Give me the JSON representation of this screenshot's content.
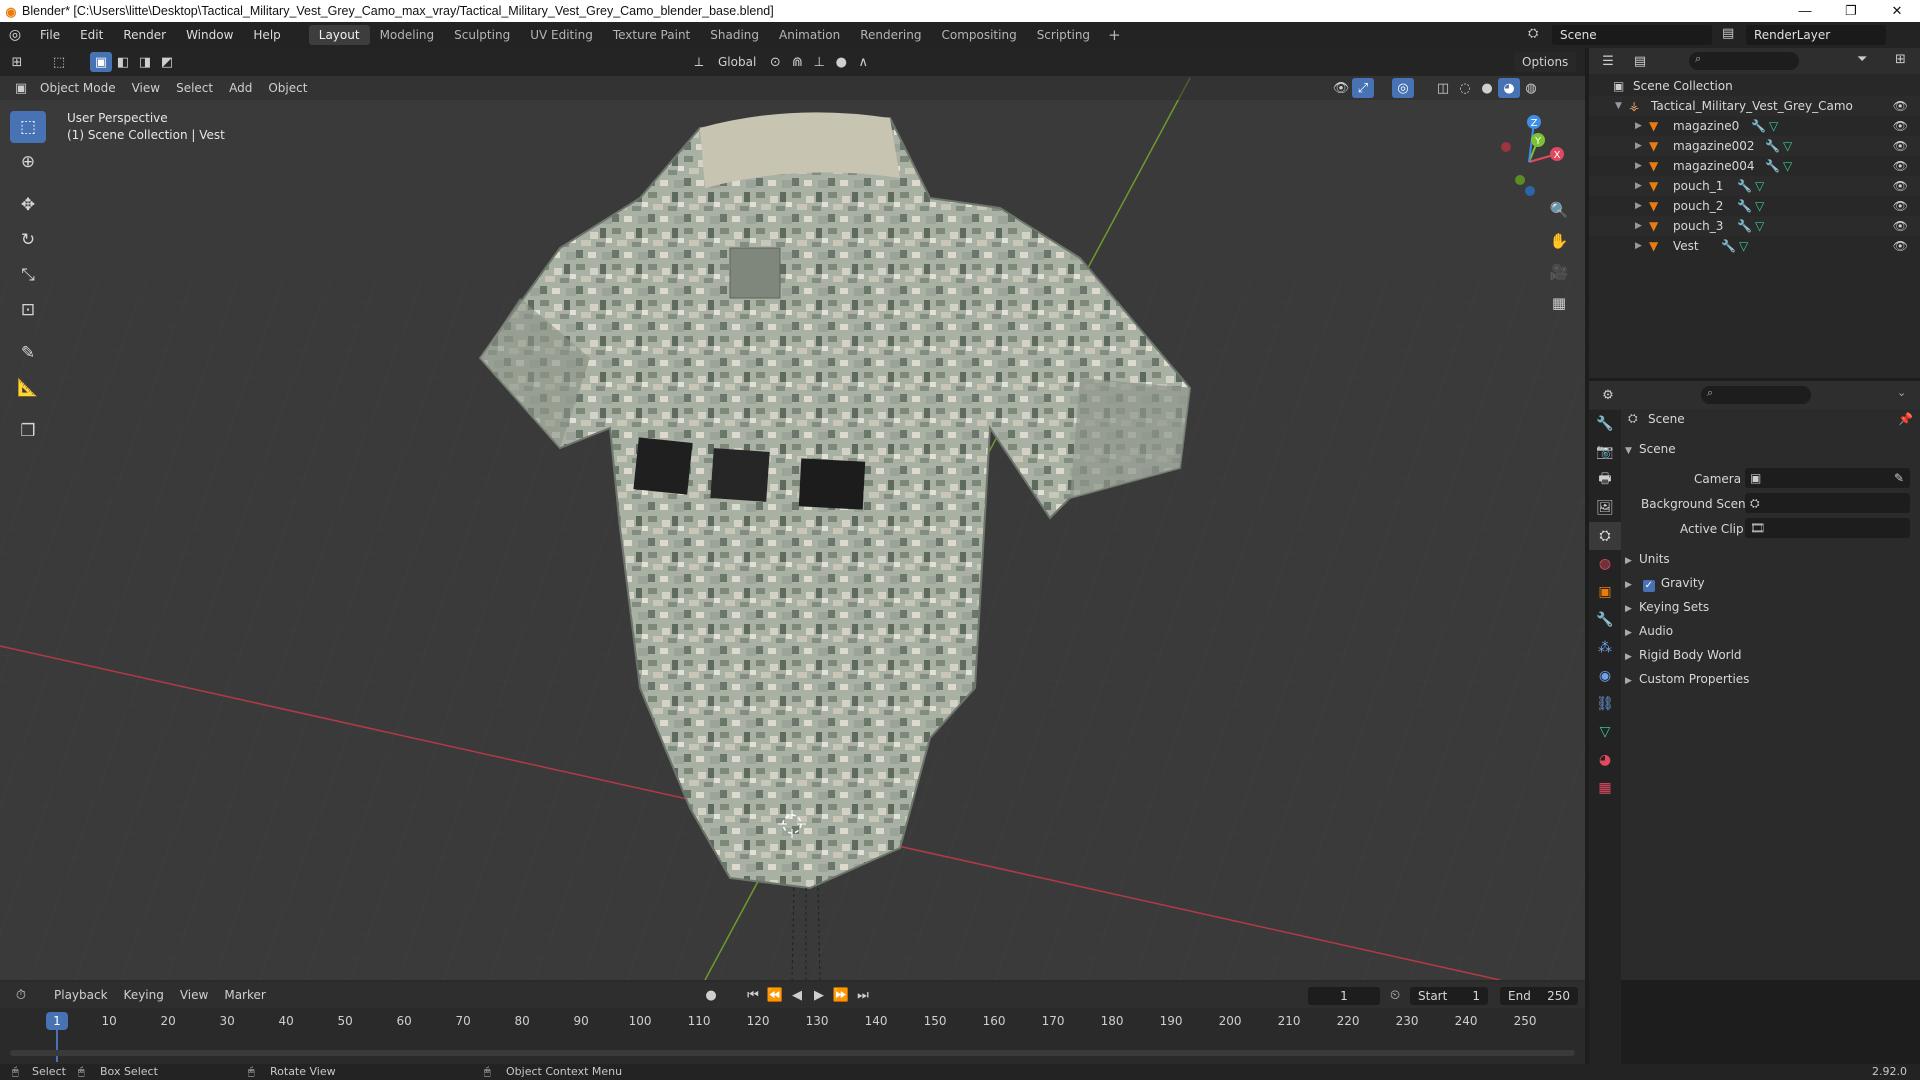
{
  "window": {
    "title": "Blender* [C:\\Users\\litte\\Desktop\\Tactical_Military_Vest_Grey_Camo_max_vray/Tactical_Military_Vest_Grey_Camo_blender_base.blend]",
    "controls": [
      "—",
      "❐",
      "✕"
    ]
  },
  "menubar": {
    "menus": [
      "File",
      "Edit",
      "Render",
      "Window",
      "Help"
    ],
    "workspaces": [
      "Layout",
      "Modeling",
      "Sculpting",
      "UV Editing",
      "Texture Paint",
      "Shading",
      "Animation",
      "Rendering",
      "Compositing",
      "Scripting"
    ],
    "active_workspace": "Layout",
    "add_workspace": "+",
    "scene_name": "Scene",
    "view_layer": "RenderLayer"
  },
  "viewport": {
    "mode": "Object Mode",
    "menus": [
      "View",
      "Select",
      "Add",
      "Object"
    ],
    "transform_orientation": "Global",
    "options_label": "Options",
    "perspective_label": "User Perspective",
    "collection_label": "(1) Scene Collection | Vest",
    "gizmo_axes": {
      "x": "X",
      "y": "Y",
      "z": "Z"
    }
  },
  "outliner": {
    "search_placeholder": "",
    "root": "Scene Collection",
    "collection": "Tactical_Military_Vest_Grey_Camo",
    "objects": [
      "magazine0",
      "magazine002",
      "magazine004",
      "pouch_1",
      "pouch_2",
      "pouch_3",
      "Vest"
    ]
  },
  "properties": {
    "context_title": "Scene",
    "panel_title": "Scene",
    "camera_label": "Camera",
    "background_scene_label": "Background Scene",
    "active_clip_label": "Active Clip",
    "panels": [
      "Units",
      "Gravity",
      "Keying Sets",
      "Audio",
      "Rigid Body World",
      "Custom Properties"
    ],
    "gravity_checked": true
  },
  "timeline": {
    "menus": [
      "Playback",
      "Keying",
      "View",
      "Marker"
    ],
    "current_frame": "1",
    "start_label": "Start",
    "start_value": "1",
    "end_label": "End",
    "end_value": "250",
    "ticks": [
      "10",
      "20",
      "30",
      "40",
      "50",
      "60",
      "70",
      "80",
      "90",
      "100",
      "110",
      "120",
      "130",
      "140",
      "150",
      "160",
      "170",
      "180",
      "190",
      "200",
      "210",
      "220",
      "230",
      "240",
      "250"
    ]
  },
  "statusbar": {
    "select": "Select",
    "box_select": "Box Select",
    "rotate_view": "Rotate View",
    "context_menu": "Object Context Menu",
    "version": "2.92.0"
  },
  "colors": {
    "accent": "#4772b3",
    "object_orange": "#e87d0d",
    "modifier_blue": "#6fa3e8",
    "mesh_green": "#38c79a",
    "axis_x": "#e0495f",
    "axis_y": "#7dc234",
    "axis_z": "#3f8ee8"
  }
}
